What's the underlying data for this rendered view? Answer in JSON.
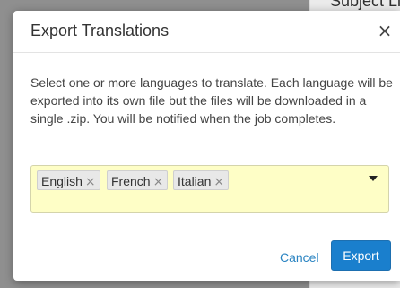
{
  "background": {
    "heading": "Subject Li"
  },
  "modal": {
    "title": "Export Translations",
    "close_icon": "×",
    "body": "Select one or more languages to translate. Each language will be exported into its own file but the files will be downloaded in a single .zip. You will be notified when the job completes.",
    "languages": {
      "selected": [
        {
          "label": "English",
          "remove_icon": "×"
        },
        {
          "label": "French",
          "remove_icon": "×"
        },
        {
          "label": "Italian",
          "remove_icon": "×"
        }
      ],
      "dropdown_icon": "caret-down-icon",
      "field_color": "#fefec6"
    },
    "footer": {
      "cancel_label": "Cancel",
      "export_label": "Export"
    }
  },
  "colors": {
    "primary_button": "#1a7fcd",
    "link": "#2a84c2",
    "overlay": "#8f8f8f"
  }
}
